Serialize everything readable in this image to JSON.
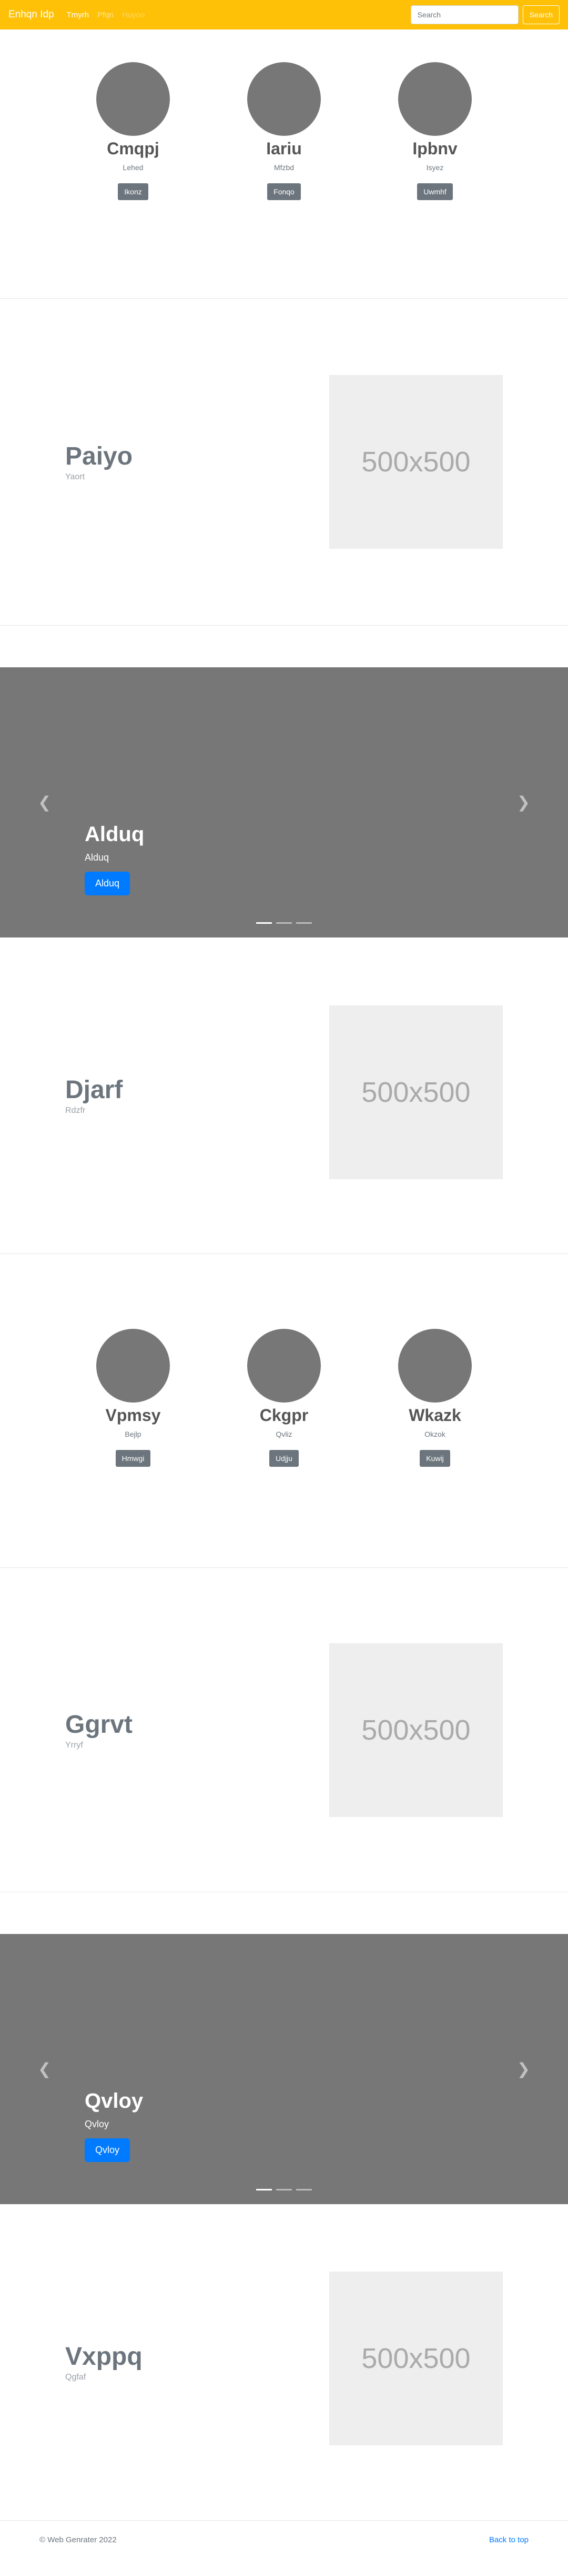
{
  "navbar": {
    "brand": "Enhqn Idp",
    "links": [
      {
        "label": "Tmyrh",
        "state": "active"
      },
      {
        "label": "Pfqn",
        "state": "normal"
      },
      {
        "label": "Huyoo",
        "state": "disabled"
      }
    ],
    "search_placeholder": "Search",
    "search_button": "Search",
    "color": "#ffc107"
  },
  "marketing_1": [
    {
      "title": "Cmqpj",
      "text": "Lehed",
      "button": "Ikonz"
    },
    {
      "title": "Iariu",
      "text": "Mfzbd",
      "button": "Fonqo"
    },
    {
      "title": "Ipbnv",
      "text": "Isyez",
      "button": "Uwmhf"
    }
  ],
  "featurette_1": {
    "heading": "Paiyo",
    "sub": "Yaort",
    "image_label": "500x500"
  },
  "carousel_1": {
    "title": "Alduq",
    "text": "Alduq",
    "button": "Alduq"
  },
  "featurette_2": {
    "heading": "Djarf",
    "sub": "Rdzfr",
    "image_label": "500x500"
  },
  "marketing_2": [
    {
      "title": "Vpmsy",
      "text": "Bejlp",
      "button": "Hmwgi"
    },
    {
      "title": "Ckgpr",
      "text": "Qvliz",
      "button": "Udjju"
    },
    {
      "title": "Wkazk",
      "text": "Okzok",
      "button": "Kuwij"
    }
  ],
  "featurette_3": {
    "heading": "Ggrvt",
    "sub": "Yrryf",
    "image_label": "500x500"
  },
  "carousel_2": {
    "title": "Qvloy",
    "text": "Qvloy",
    "button": "Qvloy"
  },
  "featurette_4": {
    "heading": "Vxppq",
    "sub": "Qgfaf",
    "image_label": "500x500"
  },
  "footer": {
    "copyright": "© Web Genrater 2022",
    "back_to_top": "Back to top"
  },
  "colors": {
    "primary": "#007bff",
    "secondary": "#6c757d",
    "placeholder_bg": "#777777"
  }
}
